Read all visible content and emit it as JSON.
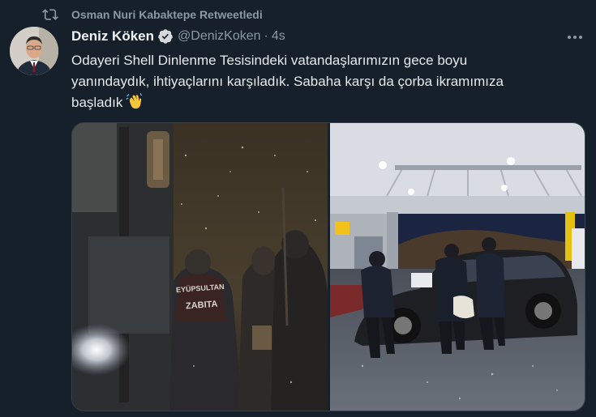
{
  "retweet": {
    "label": "Osman Nuri Kabaktepe Retweetledi",
    "icon": "retweet-icon"
  },
  "tweet": {
    "author": {
      "display_name": "Deniz Köken",
      "handle": "@DenizKoken",
      "verified": true
    },
    "separator": "·",
    "time": "4s",
    "text_lines": [
      "Odayeri Shell Dinlenme Tesisindeki vatandaşlarımızın gece boyu",
      "yanındaydık, ihtiyaçlarını karşıladık. Sabaha karşı da çorba ikramımıza",
      "başladık"
    ],
    "emoji": "waving-hand-emoji",
    "media": {
      "left_photo": {
        "vest_line1": "EYÜPSULTAN",
        "vest_line2": "ZABITA"
      }
    }
  },
  "colors": {
    "background": "#15202b",
    "muted": "#8b98a5",
    "text": "#e7e9ea",
    "verified": "#d6d9db"
  }
}
